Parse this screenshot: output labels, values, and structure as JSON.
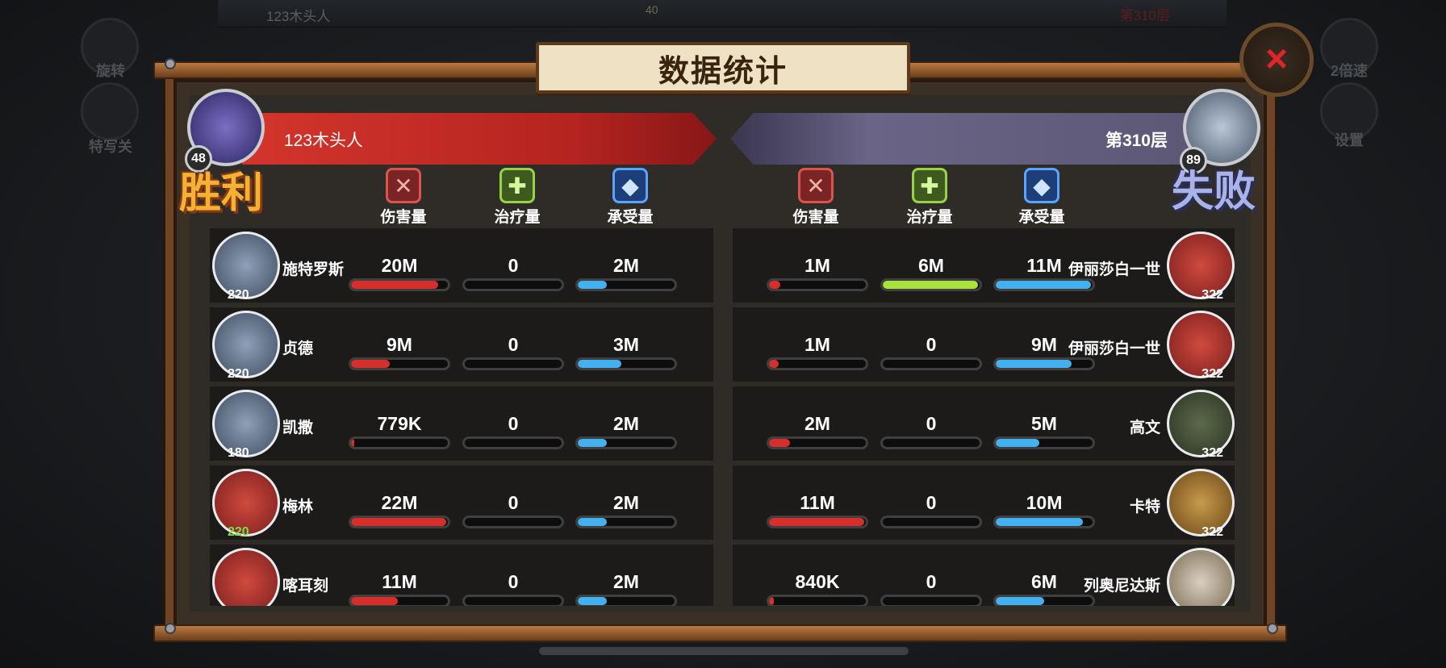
{
  "background": {
    "top_left_name": "123木头人",
    "top_mid": "40",
    "top_right": "第310层",
    "left_buttons": [
      "旋转",
      "特写关"
    ],
    "right_buttons": [
      "2倍速",
      "设置"
    ]
  },
  "title": "数据统计",
  "close_label": "×",
  "left_team": {
    "name": "123木头人",
    "level": "48",
    "result": "胜利"
  },
  "right_team": {
    "name": "第310层",
    "level": "89",
    "result": "失败"
  },
  "stat_headers": {
    "damage": "伤害量",
    "heal": "治疗量",
    "taken": "承受量"
  },
  "left_heroes": [
    {
      "name": "施特罗斯",
      "level": "220",
      "damage": "20M",
      "heal": "0",
      "taken": "2M",
      "damage_pct": 0.9,
      "heal_pct": 0,
      "taken_pct": 0.3
    },
    {
      "name": "贞德",
      "level": "220",
      "damage": "9M",
      "heal": "0",
      "taken": "3M",
      "damage_pct": 0.4,
      "heal_pct": 0,
      "taken_pct": 0.45
    },
    {
      "name": "凯撒",
      "level": "180",
      "damage": "779K",
      "heal": "0",
      "taken": "2M",
      "damage_pct": 0.03,
      "heal_pct": 0,
      "taken_pct": 0.3
    },
    {
      "name": "梅林",
      "level": "220",
      "damage": "22M",
      "heal": "0",
      "taken": "2M",
      "damage_pct": 0.98,
      "heal_pct": 0,
      "taken_pct": 0.3
    },
    {
      "name": "喀耳刻",
      "level": "",
      "damage": "11M",
      "heal": "0",
      "taken": "2M",
      "damage_pct": 0.48,
      "heal_pct": 0,
      "taken_pct": 0.3
    }
  ],
  "right_heroes": [
    {
      "name": "伊丽莎白一世",
      "level": "322",
      "damage": "1M",
      "heal": "6M",
      "taken": "11M",
      "damage_pct": 0.12,
      "heal_pct": 0.98,
      "taken_pct": 0.98
    },
    {
      "name": "伊丽莎白一世",
      "level": "322",
      "damage": "1M",
      "heal": "0",
      "taken": "9M",
      "damage_pct": 0.1,
      "heal_pct": 0,
      "taken_pct": 0.78
    },
    {
      "name": "高文",
      "level": "322",
      "damage": "2M",
      "heal": "0",
      "taken": "5M",
      "damage_pct": 0.22,
      "heal_pct": 0,
      "taken_pct": 0.45
    },
    {
      "name": "卡特",
      "level": "322",
      "damage": "11M",
      "heal": "0",
      "taken": "10M",
      "damage_pct": 0.98,
      "heal_pct": 0,
      "taken_pct": 0.9
    },
    {
      "name": "列奥尼达斯",
      "level": "",
      "damage": "840K",
      "heal": "0",
      "taken": "6M",
      "damage_pct": 0.05,
      "heal_pct": 0,
      "taken_pct": 0.5
    }
  ]
}
